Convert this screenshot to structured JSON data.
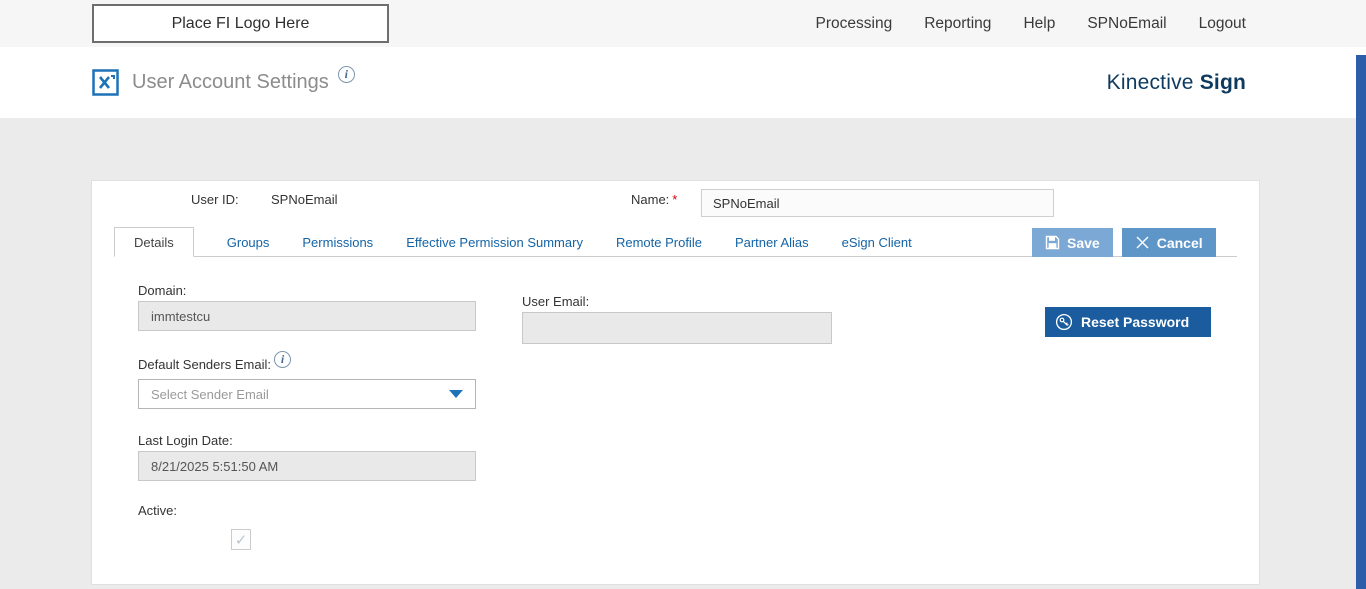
{
  "topbar": {
    "logo_placeholder": "Place FI Logo Here",
    "nav": [
      {
        "label": "Processing"
      },
      {
        "label": "Reporting"
      },
      {
        "label": "Help"
      },
      {
        "label": "SPNoEmail"
      },
      {
        "label": "Logout"
      }
    ]
  },
  "header": {
    "title": "User Account Settings",
    "brand_name": "Kinective",
    "brand_product": "Sign"
  },
  "user_summary": {
    "user_id_label": "User ID:",
    "user_id_value": "SPNoEmail",
    "name_label": "Name:",
    "name_required": "*",
    "name_value": "SPNoEmail"
  },
  "tabs": [
    {
      "label": "Details",
      "active": true
    },
    {
      "label": "Groups",
      "active": false
    },
    {
      "label": "Permissions",
      "active": false
    },
    {
      "label": "Effective Permission Summary",
      "active": false
    },
    {
      "label": "Remote Profile",
      "active": false
    },
    {
      "label": "Partner Alias",
      "active": false
    },
    {
      "label": "eSign Client",
      "active": false
    }
  ],
  "actions": {
    "save_label": "Save",
    "cancel_label": "Cancel"
  },
  "form": {
    "domain_label": "Domain:",
    "domain_value": "immtestcu",
    "user_email_label": "User Email:",
    "user_email_value": "",
    "reset_password_label": "Reset Password",
    "default_senders_email_label": "Default Senders Email:",
    "default_senders_email_placeholder": "Select Sender Email",
    "last_login_label": "Last Login Date:",
    "last_login_value": "8/21/2025 5:51:50 AM",
    "active_label": "Active:",
    "active_checked": true
  },
  "icons": {
    "info": "i",
    "check": "✓"
  },
  "colors": {
    "accent_blue": "#1e72b8",
    "brand_navy": "#0e3a5f",
    "tab_link_blue": "#1464a5",
    "save_button": "#7ba8d4",
    "cancel_button": "#5e96c8",
    "reset_button": "#1a5c9e",
    "scrollbar_blue": "#2b5da9"
  }
}
